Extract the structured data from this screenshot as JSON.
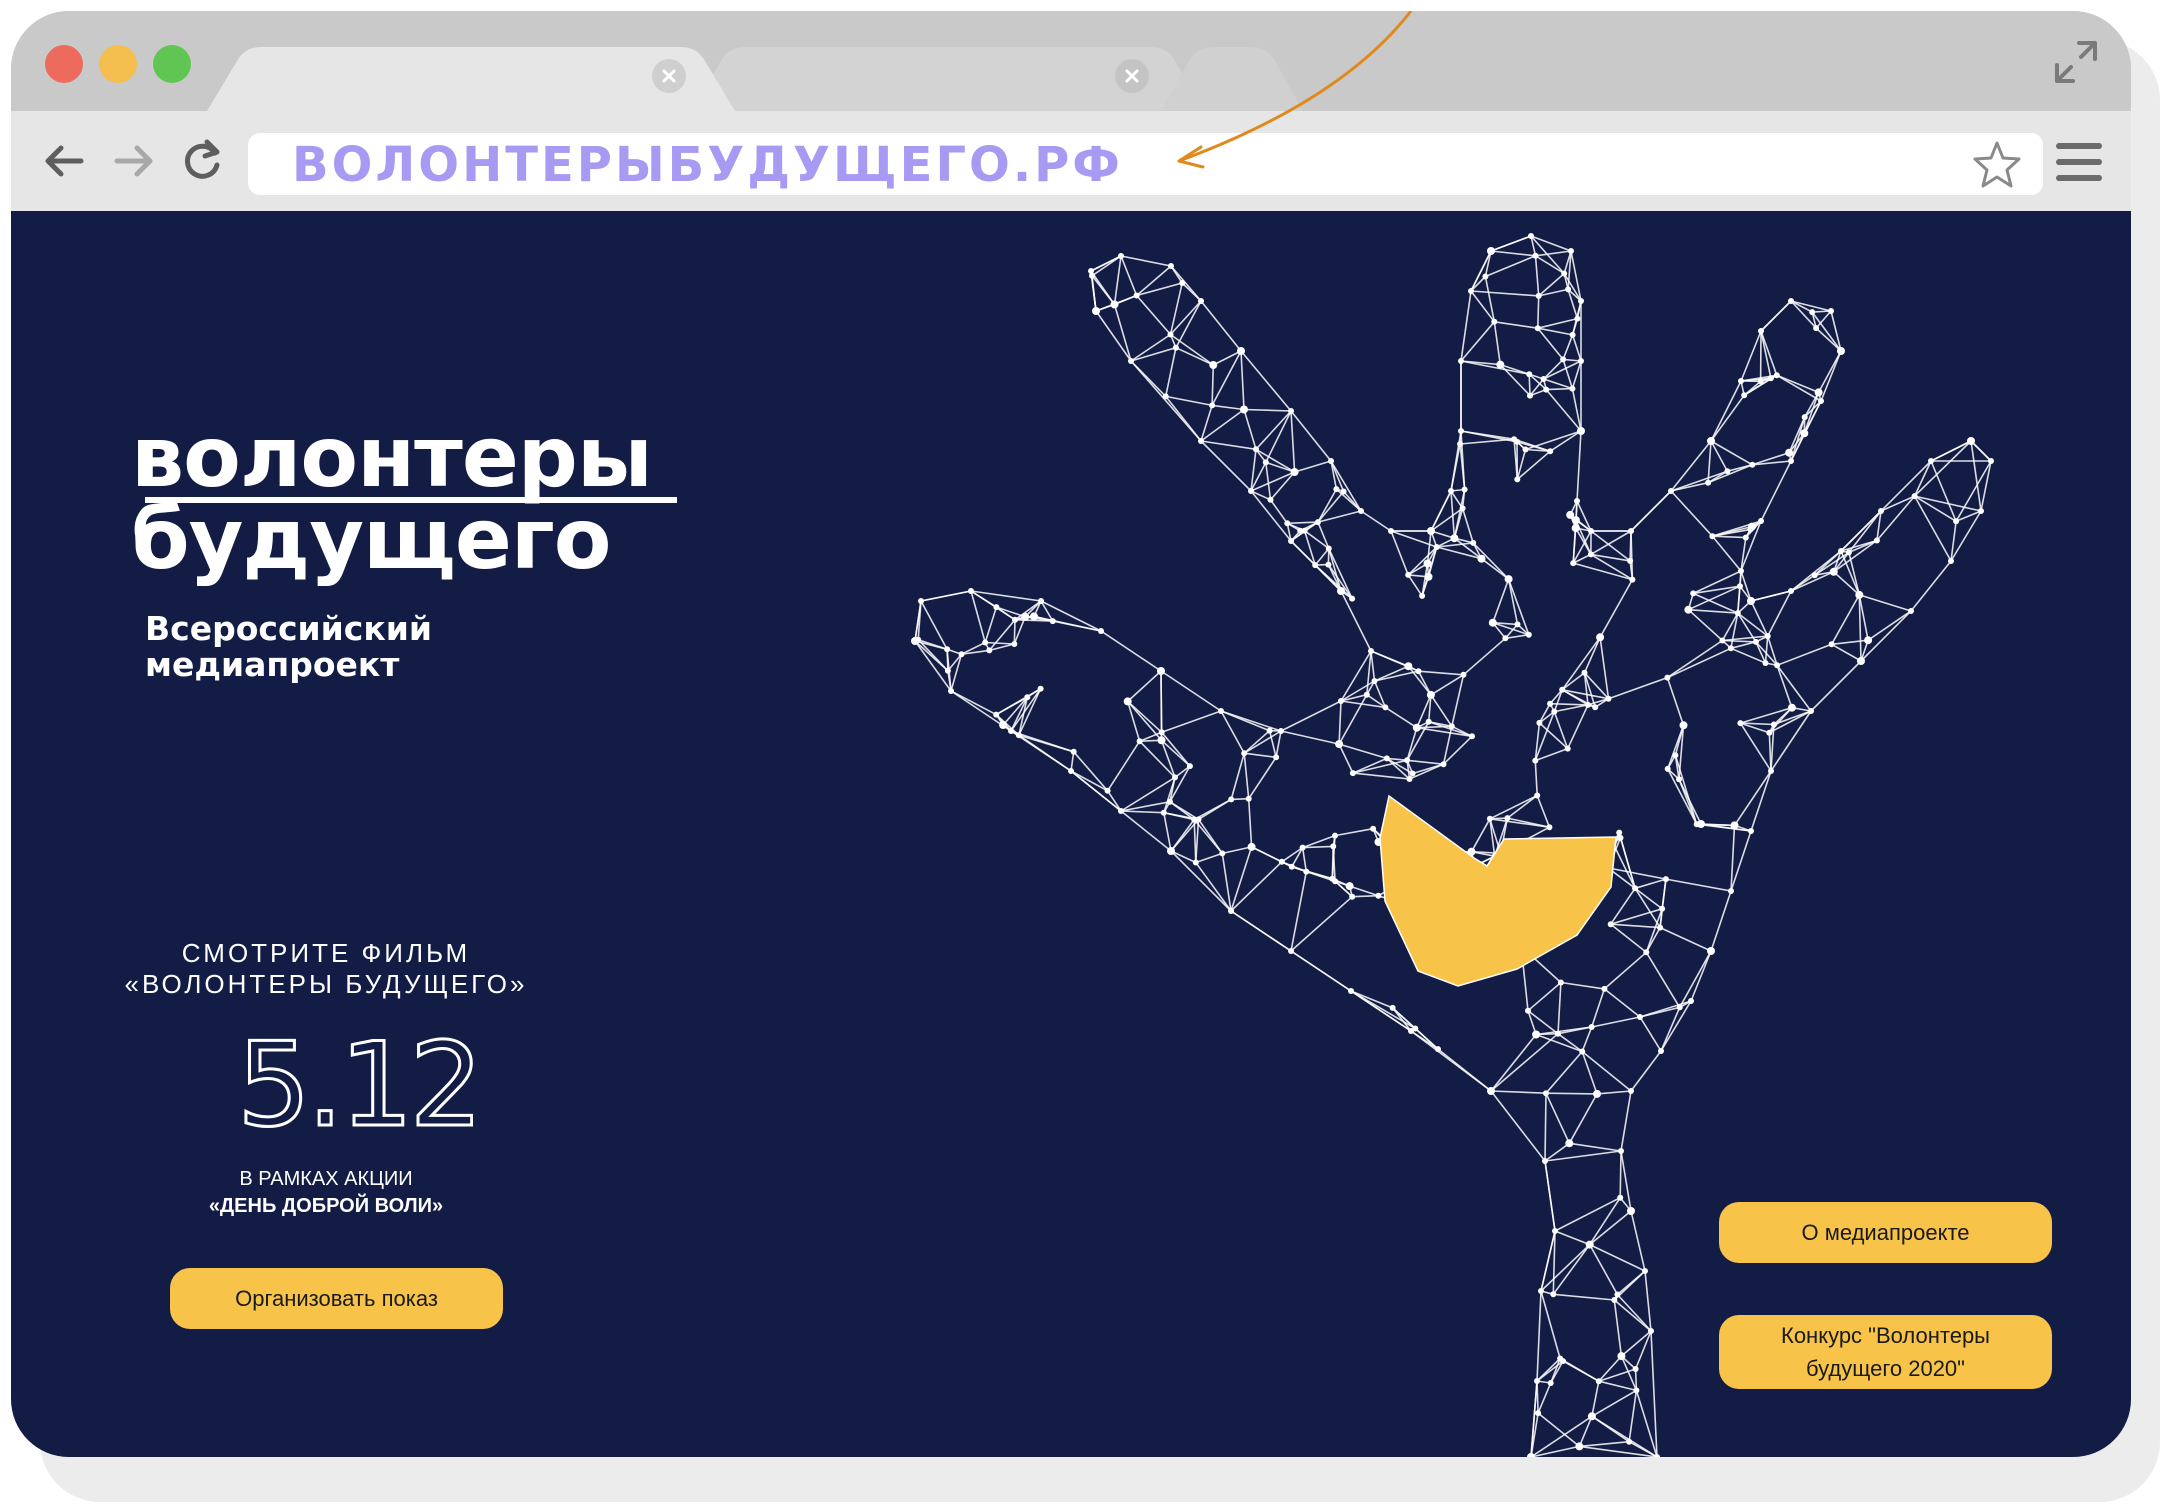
{
  "browser": {
    "url": "ВОЛОНТЕРЫБУДУЩЕГО.РФ",
    "colors": {
      "close": "#ec6a5e",
      "minimize": "#f4bf4f",
      "maximize": "#61c554",
      "url_text": "#a79af2"
    }
  },
  "hero": {
    "logo_line1": "волонтеры",
    "logo_line2": "будущего",
    "subtitle_line1": "Всероссийский",
    "subtitle_line2": "медиапроект"
  },
  "film_promo": {
    "line1": "СМОТРИТЕ ФИЛЬМ",
    "line2": "«ВОЛОНТЕРЫ БУДУЩЕГО»",
    "date": "5.12",
    "campaign_line1": "В РАМКАХ АКЦИИ",
    "campaign_line2": "«ДЕНЬ ДОБРОЙ ВОЛИ»"
  },
  "buttons": {
    "organize": "Организовать показ",
    "about": "О медиапроекте",
    "contest": "Конкурс \"Волонтеры будущего 2020\""
  },
  "theme": {
    "background": "#131c44",
    "accent": "#f7c349",
    "mesh": "#ffffff"
  },
  "icons": {
    "back": "arrow-left-icon",
    "forward": "arrow-right-icon",
    "reload": "reload-icon",
    "bookmark": "star-icon",
    "menu": "hamburger-menu-icon",
    "fullscreen": "fullscreen-icon",
    "tab_close": "tab-close-icon",
    "hand": "polygon-hand-illustration",
    "heart": "heart-icon"
  }
}
